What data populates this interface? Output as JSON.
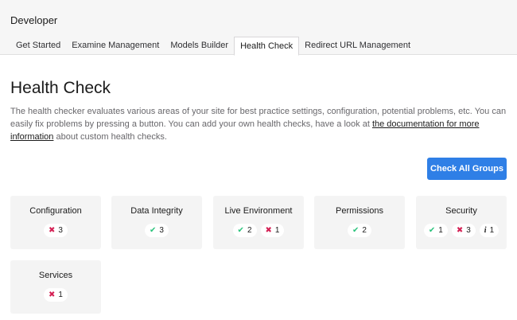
{
  "section": {
    "title": "Developer"
  },
  "tabs": [
    {
      "label": "Get Started"
    },
    {
      "label": "Examine Management"
    },
    {
      "label": "Models Builder"
    },
    {
      "label": "Health Check"
    },
    {
      "label": "Redirect URL Management"
    }
  ],
  "page": {
    "title": "Health Check",
    "desc_part1": "The health checker evaluates various areas of your site for best practice settings, configuration, potential problems, etc. You can easily fix problems by pressing a button. You can add your own health checks, have a look at ",
    "desc_link": "the documentation for more information",
    "desc_part2": " about custom health checks."
  },
  "actions": {
    "check_all": "Check All Groups"
  },
  "groups": [
    {
      "name": "Configuration",
      "success": "",
      "error": "3",
      "info": ""
    },
    {
      "name": "Data Integrity",
      "success": "3",
      "error": "",
      "info": ""
    },
    {
      "name": "Live Environment",
      "success": "2",
      "error": "1",
      "info": ""
    },
    {
      "name": "Permissions",
      "success": "2",
      "error": "",
      "info": ""
    },
    {
      "name": "Security",
      "success": "1",
      "error": "3",
      "info": "1"
    },
    {
      "name": "Services",
      "success": "",
      "error": "1",
      "info": ""
    }
  ],
  "icons": {
    "success": "check-icon",
    "error": "cross-icon",
    "info": "info-icon"
  },
  "colors": {
    "accent": "#2f7fe6",
    "success": "#2bc37c",
    "error": "#d42054"
  }
}
